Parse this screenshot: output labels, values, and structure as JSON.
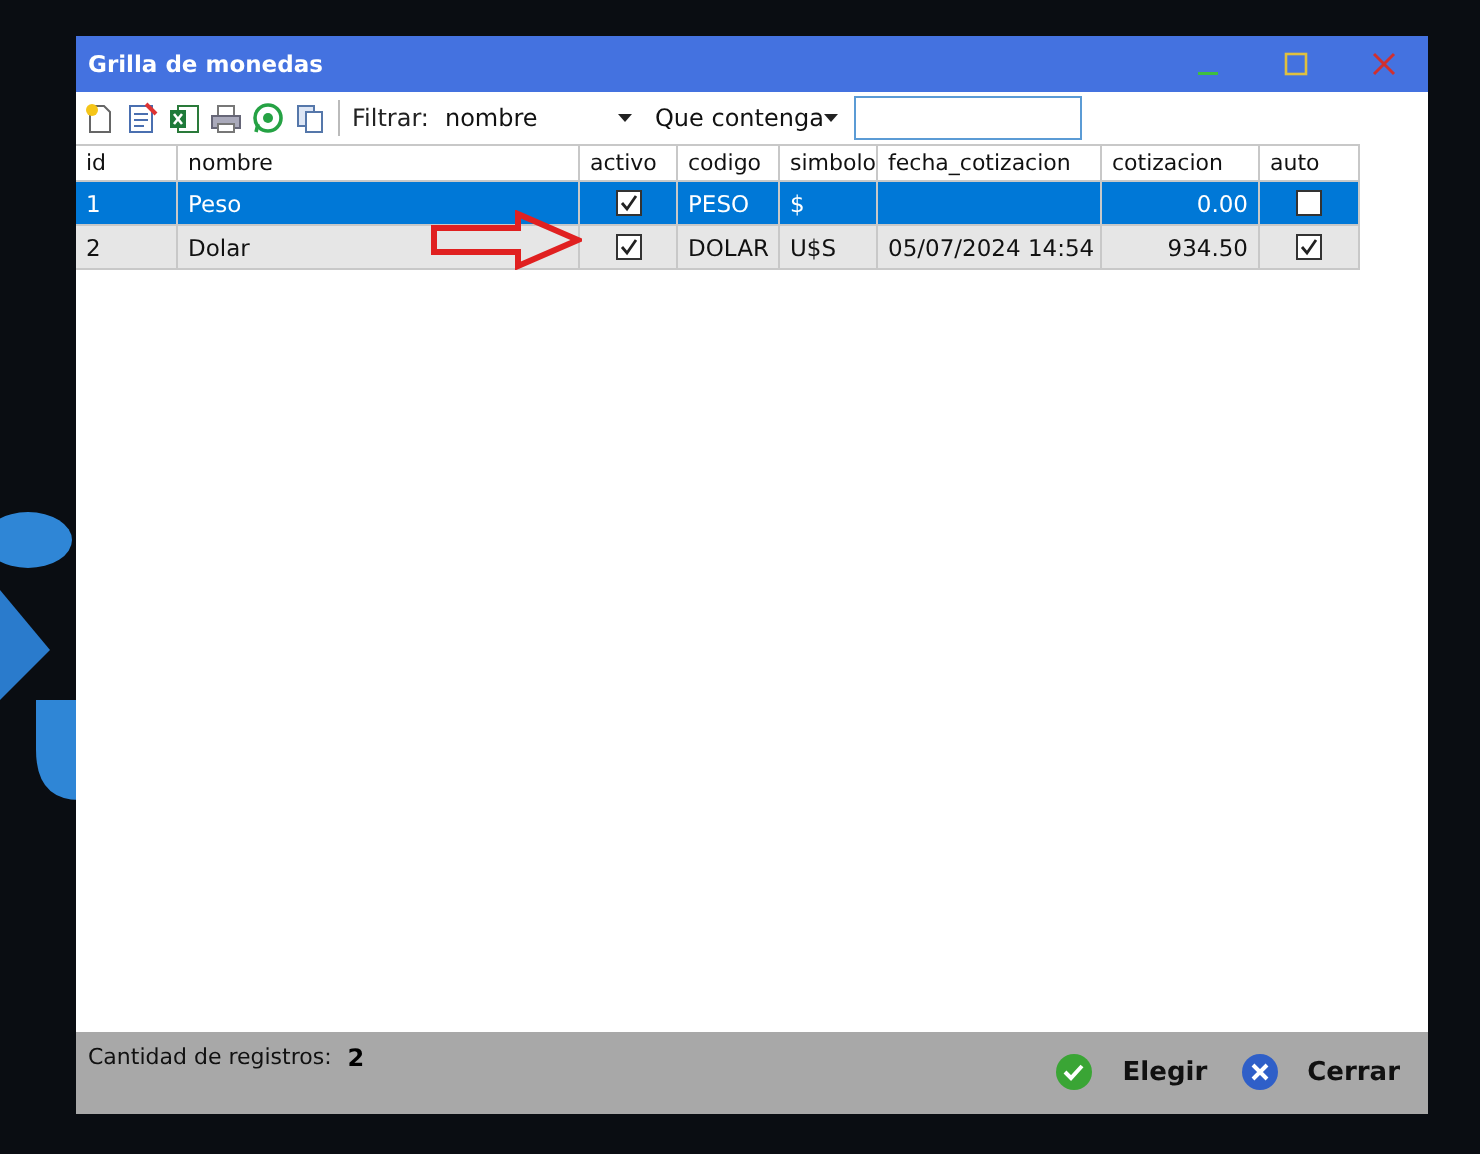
{
  "window": {
    "title": "Grilla de monedas"
  },
  "toolbar": {
    "filter_label": "Filtrar:",
    "filter_field": "nombre",
    "filter_condition": "Que contenga"
  },
  "table": {
    "columns": [
      "id",
      "nombre",
      "activo",
      "codigo",
      "simbolo",
      "fecha_cotizacion",
      "cotizacion",
      "auto"
    ],
    "rows": [
      {
        "id": "1",
        "nombre": "Peso",
        "activo": true,
        "codigo": "PESO",
        "simbolo": "$",
        "cotizacion": "0.00",
        "auto": false,
        "selected": true
      },
      {
        "id": "2",
        "nombre": "Dolar",
        "activo": true,
        "codigo": "DOLAR",
        "simbolo": "U$S",
        "fecha_cotizacion": "05/07/2024 14:54",
        "cotizacion": "934.50",
        "auto": true,
        "selected": false
      }
    ]
  },
  "status_bar": {
    "count_label": "Cantidad de registros:",
    "count": "2",
    "buttons": [
      {
        "kind": "ok",
        "label": "Elegir"
      },
      {
        "kind": "close",
        "label": "Cerrar"
      }
    ]
  }
}
